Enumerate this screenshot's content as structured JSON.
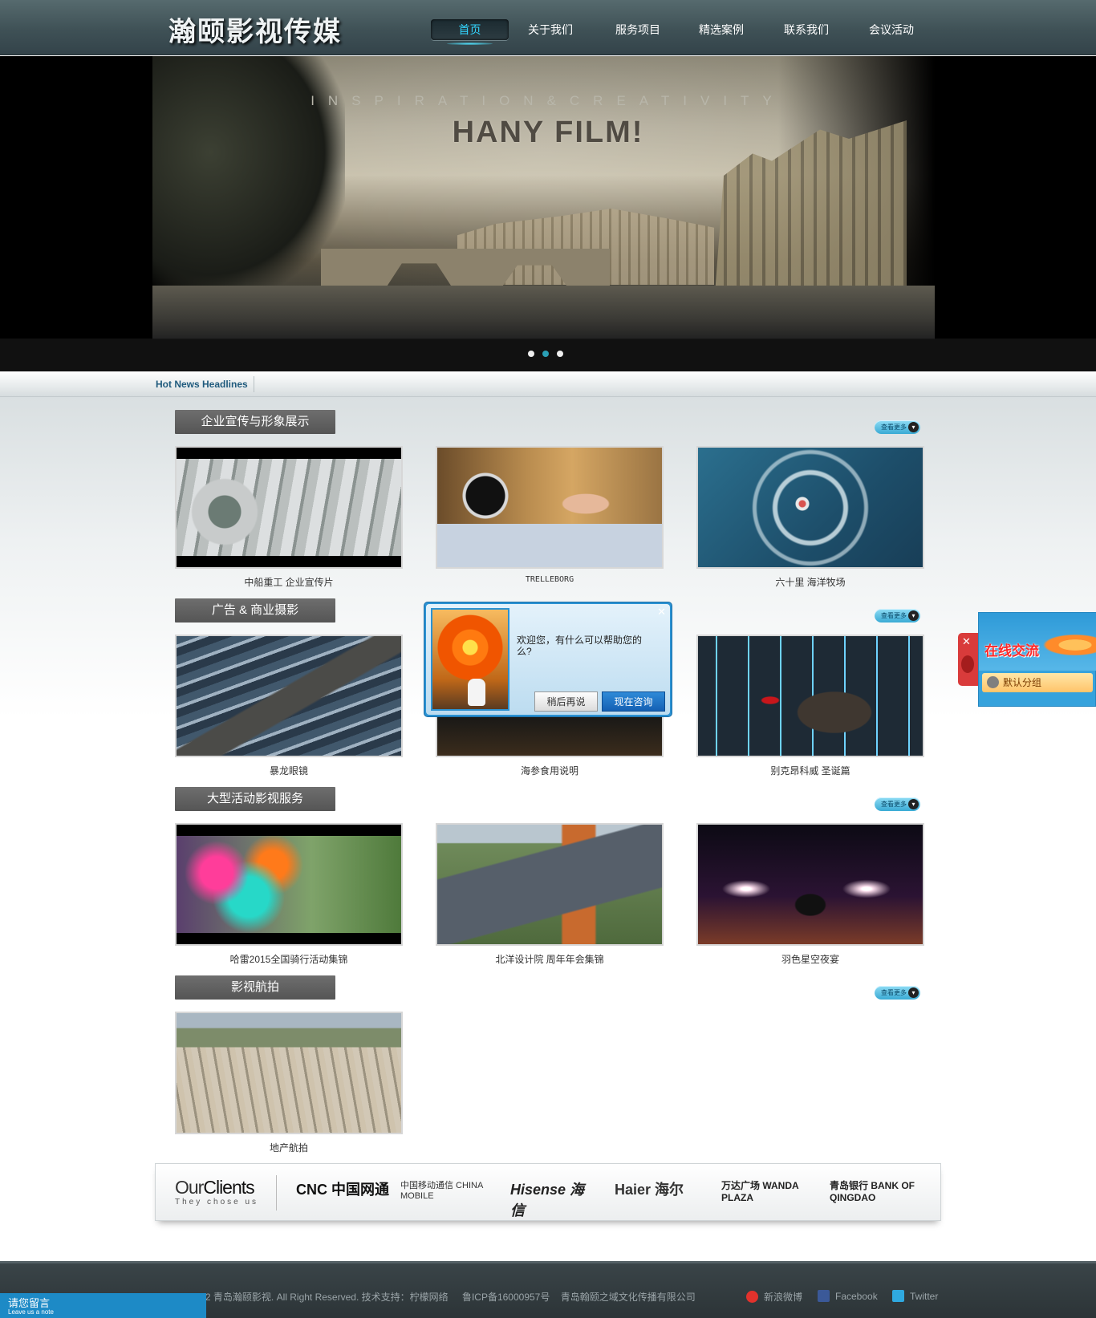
{
  "header": {
    "logo": "瀚颐影视传媒",
    "nav": [
      "首页",
      "关于我们",
      "服务项目",
      "精选案例",
      "联系我们",
      "会议活动"
    ],
    "active_index": 0
  },
  "banner": {
    "tagline": "INSPIRATION&CREATIVITY",
    "headline": "HANY FILM!",
    "slides": 3,
    "active_slide": 2
  },
  "news": {
    "label": "Hot News Headlines"
  },
  "sections": [
    {
      "title": "企业宣传与形象展示",
      "more": "查看更多",
      "items": [
        {
          "caption": "中船重工  企业宣传片"
        },
        {
          "caption": "TRELLEBORG"
        },
        {
          "caption": "六十里  海洋牧场"
        }
      ]
    },
    {
      "title": "广告 & 商业摄影",
      "more": "查看更多",
      "items": [
        {
          "caption": "暴龙眼镜"
        },
        {
          "caption": "海参食用说明"
        },
        {
          "caption": "别克昂科威  圣诞篇"
        }
      ]
    },
    {
      "title": "大型活动影视服务",
      "more": "查看更多",
      "items": [
        {
          "caption": "哈雷2015全国骑行活动集锦"
        },
        {
          "caption": "北洋设计院  周年年会集锦"
        },
        {
          "caption": "羽色星空夜宴"
        }
      ]
    },
    {
      "title": "影视航拍",
      "more": "查看更多",
      "items": [
        {
          "caption": "地产航拍"
        }
      ]
    }
  ],
  "clients": {
    "title_a": "Our",
    "title_b": "Clients",
    "subtitle": "They chose us",
    "logos": [
      "CNC 中国网通",
      "中国移动通信 CHINA MOBILE",
      "Hisense 海信",
      "Haier 海尔",
      "万达广场 WANDA PLAZA",
      "青岛银行 BANK OF QINGDAO"
    ]
  },
  "popup": {
    "message": "欢迎您，有什么可以帮助您的么?",
    "later": "稍后再说",
    "now": "现在咨询"
  },
  "sidechat": {
    "title": "在线交流",
    "group": "默认分组"
  },
  "footer": {
    "copyright": "© 2010-2012 青岛瀚颐影视. All Right Reserved.  技术支持：柠檬网络",
    "icp": "鲁ICP备16000957号",
    "company": "青岛翰颐之域文化传播有限公司",
    "weibo": "新浪微博",
    "facebook": "Facebook",
    "twitter": "Twitter"
  },
  "leave_note": {
    "zh": "请您留言",
    "en": "Leave us a note"
  },
  "colors": {
    "accent": "#33d6ff",
    "news": "#1f5a7d",
    "chat_blue": "#2b92d3",
    "footer": "#2c3437"
  }
}
